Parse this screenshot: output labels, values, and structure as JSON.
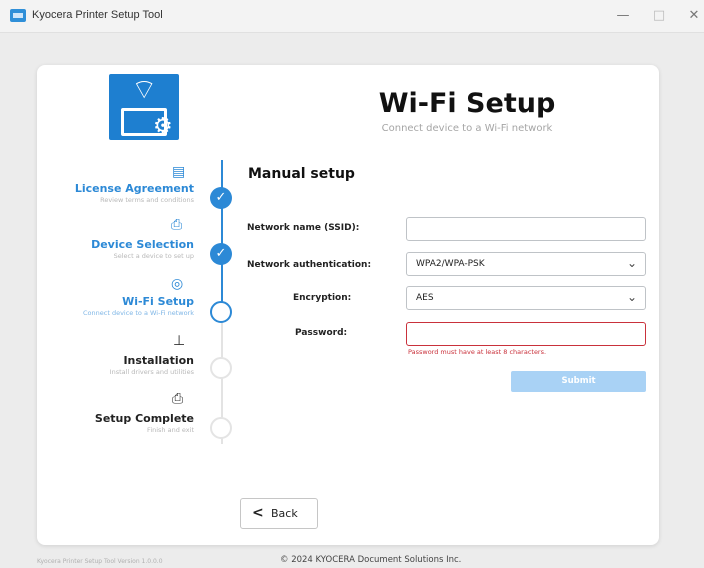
{
  "window": {
    "title": "Kyocera Printer Setup Tool",
    "minimize_glyph": "—",
    "maximize_glyph": "□",
    "close_glyph": "✕"
  },
  "header": {
    "title": "Wi-Fi Setup",
    "subtitle": "Connect device to a Wi-Fi network",
    "icon": "printer-wifi-gear-icon"
  },
  "steps": [
    {
      "title": "License Agreement",
      "subtitle": "Review terms and conditions",
      "status": "done",
      "icon": "document-icon"
    },
    {
      "title": "Device Selection",
      "subtitle": "Select a device to set up",
      "status": "done",
      "icon": "printer-search-icon"
    },
    {
      "title": "Wi-Fi Setup",
      "subtitle": "Connect device to a Wi-Fi network",
      "status": "current",
      "icon": "wifi-icon"
    },
    {
      "title": "Installation",
      "subtitle": "Install drivers and utilities",
      "status": "pending",
      "icon": "laptop-download-icon"
    },
    {
      "title": "Setup Complete",
      "subtitle": "Finish and exit",
      "status": "pending",
      "icon": "printer-check-icon"
    }
  ],
  "form": {
    "section_title": "Manual setup",
    "ssid": {
      "label": "Network name (SSID):",
      "value": ""
    },
    "auth": {
      "label": "Network authentication:",
      "value": "WPA2/WPA-PSK"
    },
    "encryption": {
      "label": "Encryption:",
      "value": "AES"
    },
    "password": {
      "label": "Password:",
      "value": "",
      "error": "Password must have at least 8 characters."
    },
    "submit_label": "Submit"
  },
  "nav": {
    "back_label": "Back",
    "back_glyph": "<"
  },
  "footer": {
    "version": "Kyocera Printer Setup Tool Version 1.0.0.0",
    "copyright": "© 2024 KYOCERA Document Solutions Inc."
  },
  "colors": {
    "accent": "#2c89d6",
    "error": "#c9313b",
    "submit_disabled": "#a9d2f5"
  }
}
